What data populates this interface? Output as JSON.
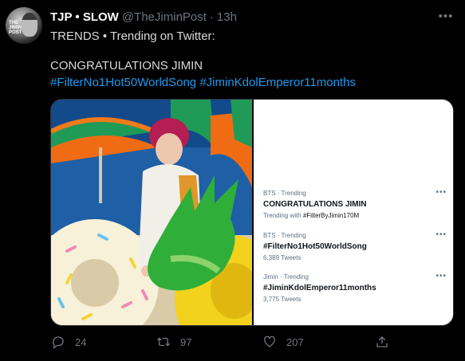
{
  "tweet": {
    "author_name": "TJP • SLOW",
    "handle": "@TheJiminPost",
    "separator": "·",
    "time": "13h",
    "more": "•••",
    "avatar_text": "THE JIMIN POST",
    "lines": [
      "TRENDS • Trending on Twitter:",
      "CONGRATULATIONS JIMIN"
    ],
    "hashtags": [
      "#FilterNo1Hot50WorldSong",
      "#JiminKdolEmperor11months"
    ]
  },
  "trends": [
    {
      "meta": "BTS · Trending",
      "name": "CONGRATULATIONS JIMIN",
      "sub_prefix": "Trending with ",
      "sub_tag": "#FilterByJimin170M",
      "more": "•••"
    },
    {
      "meta": "BTS · Trending",
      "name": "#FilterNo1Hot50WorldSong",
      "sub": "6,389 Tweets",
      "more": "•••"
    },
    {
      "meta": "Jimin · Trending",
      "name": "#JiminKdolEmperor11months",
      "sub": "3,775 Tweets",
      "more": "•••"
    }
  ],
  "actions": {
    "replies": "24",
    "retweets": "97",
    "likes": "207"
  },
  "icons": [
    "reply-icon",
    "retweet-icon",
    "like-icon",
    "share-icon"
  ],
  "colors": {
    "background": "#000000",
    "link": "#1d9bf0",
    "muted": "#6e767d"
  }
}
